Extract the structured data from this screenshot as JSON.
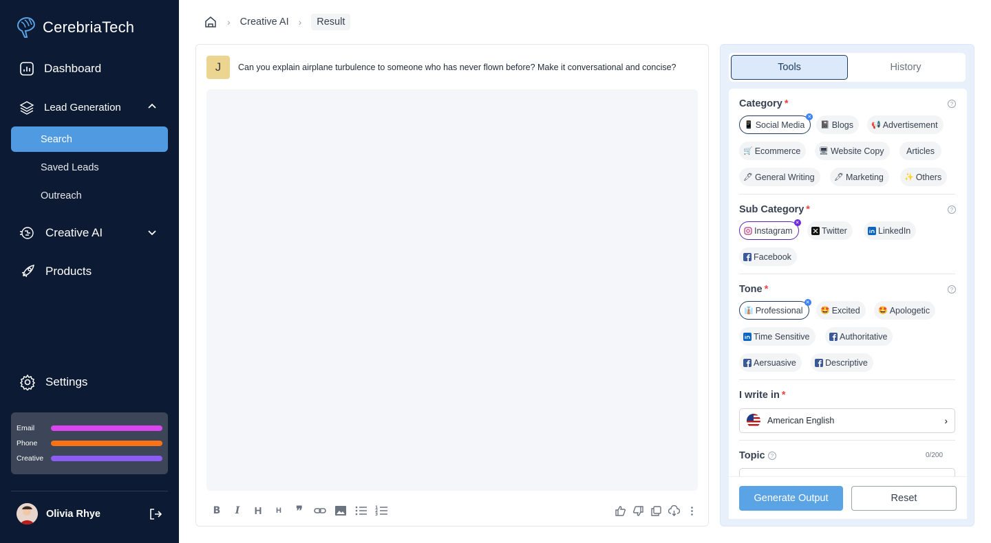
{
  "app": {
    "name": "CerebriaTech"
  },
  "sidebar": {
    "dashboard": "Dashboard",
    "lead_generation": "Lead Generation",
    "lead_sub": [
      "Search",
      "Saved Leads",
      "Outreach"
    ],
    "creative_ai": "Creative AI",
    "products": "Products",
    "settings": "Settings",
    "usage": [
      {
        "label": "Email",
        "color": "#d946ef"
      },
      {
        "label": "Phone",
        "color": "#f97316"
      },
      {
        "label": "Creative",
        "color": "#8b5cf6"
      }
    ],
    "user": {
      "name": "Olivia Rhye"
    }
  },
  "breadcrumb": {
    "items": [
      "Creative AI",
      "Result"
    ]
  },
  "chat": {
    "avatar_initial": "J",
    "question": "Can you explain airplane turbulence to someone who has never flown before? Make it conversational and concise?"
  },
  "tools": {
    "tabs": [
      "Tools",
      "History"
    ],
    "category": {
      "title": "Category",
      "chips": [
        {
          "icon": "📱",
          "label": "Social Media"
        },
        {
          "icon": "📓",
          "label": "Blogs"
        },
        {
          "icon": "📢",
          "label": "Advertisement"
        },
        {
          "icon": "🛒",
          "label": "Ecommerce"
        },
        {
          "icon": "🖥",
          "label": "Website Copy"
        },
        {
          "icon": "",
          "label": "Articles"
        },
        {
          "icon": "🖊",
          "label": "General Writing"
        },
        {
          "icon": "🖊",
          "label": "Marketing"
        },
        {
          "icon": "✨",
          "label": "Others"
        }
      ]
    },
    "subcategory": {
      "title": "Sub Category",
      "chips": [
        {
          "icon": "instagram-icon",
          "label": "Instagram"
        },
        {
          "icon": "x-icon",
          "label": "Twitter"
        },
        {
          "icon": "linkedin-icon",
          "label": "LinkedIn"
        },
        {
          "icon": "facebook-icon",
          "label": "Facebook"
        }
      ]
    },
    "tone": {
      "title": "Tone",
      "chips": [
        {
          "icon": "👔",
          "label": "Professional"
        },
        {
          "icon": "🤩",
          "label": "Excited"
        },
        {
          "icon": "🤩",
          "label": "Apologetic"
        },
        {
          "icon": "linkedin-icon",
          "label": "Time Sensitive"
        },
        {
          "icon": "facebook-icon",
          "label": "Authoritative"
        },
        {
          "icon": "facebook-icon",
          "label": "Aersuasive"
        },
        {
          "icon": "facebook-icon",
          "label": "Descriptive"
        }
      ]
    },
    "language": {
      "title": "I write in",
      "value": "American English"
    },
    "topic": {
      "title": "Topic",
      "counter": "0/200"
    },
    "generate": "Generate Output",
    "reset": "Reset"
  },
  "colors": {
    "sidebar": "#0c1a33",
    "accent": "#4f9ae0"
  }
}
